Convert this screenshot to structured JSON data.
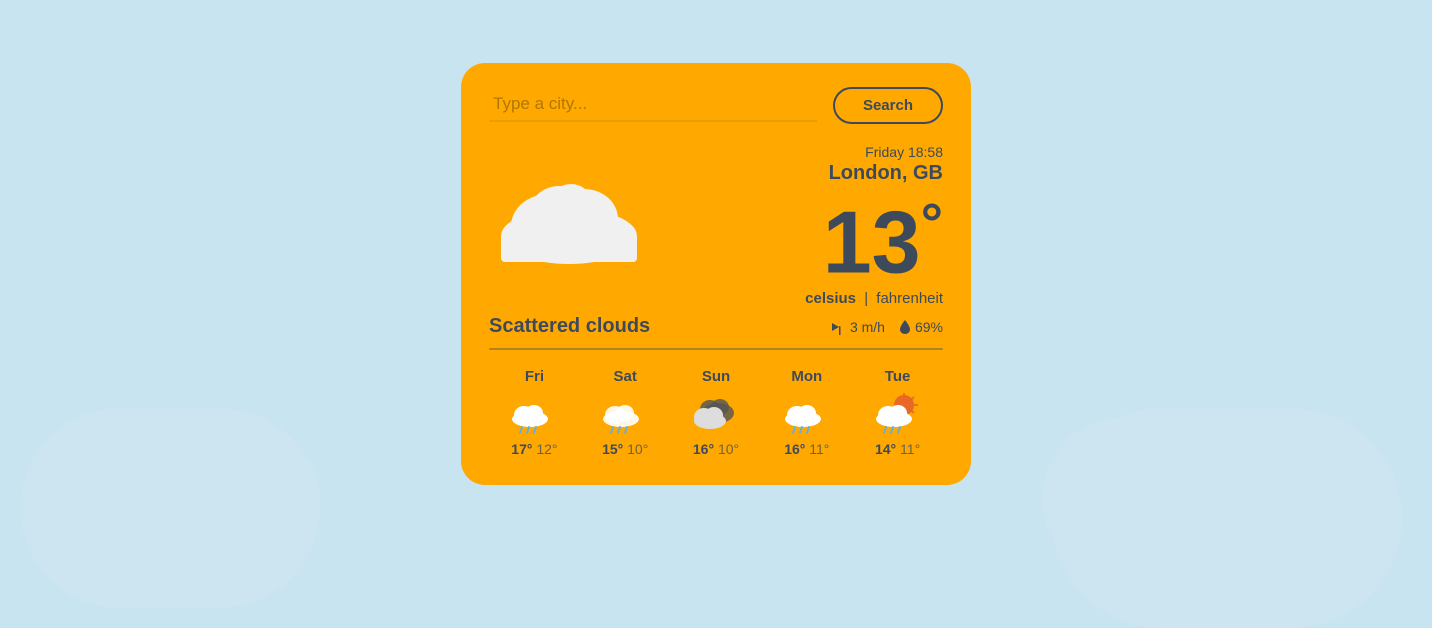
{
  "search": {
    "placeholder": "Type a city...",
    "button_label": "Search",
    "current_value": ""
  },
  "weather": {
    "datetime": "Friday 18:58",
    "location": "London, GB",
    "temperature": "13",
    "degree_symbol": "°",
    "unit_celsius": "celsius",
    "unit_separator": "|",
    "unit_fahrenheit": "fahrenheit",
    "description": "Scattered clouds",
    "wind_speed": "3 m/h",
    "humidity": "69%",
    "accent_color": "#FFA800",
    "text_color": "#3d4a5c"
  },
  "forecast": [
    {
      "day": "Fri",
      "high": "17°",
      "low": "12°",
      "icon": "rain-sun"
    },
    {
      "day": "Sat",
      "high": "15°",
      "low": "10°",
      "icon": "rain-sun"
    },
    {
      "day": "Sun",
      "high": "16°",
      "low": "10°",
      "icon": "cloud-dark"
    },
    {
      "day": "Mon",
      "high": "16°",
      "low": "11°",
      "icon": "rain-sun"
    },
    {
      "day": "Tue",
      "high": "14°",
      "low": "11°",
      "icon": "rain-sun-orange"
    }
  ]
}
